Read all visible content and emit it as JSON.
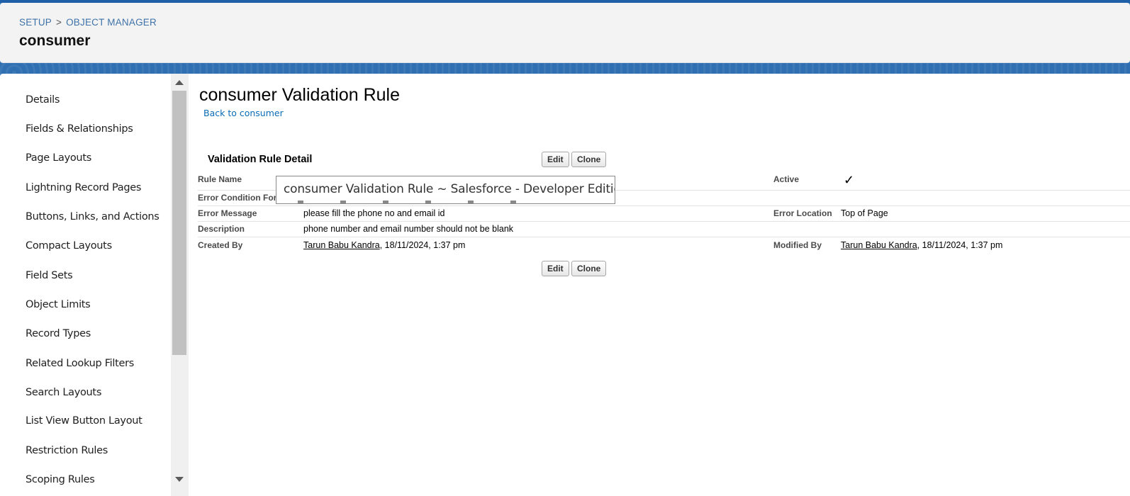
{
  "header": {
    "breadcrumb": {
      "setup": "SETUP",
      "separator": ">",
      "object_manager": "OBJECT MANAGER"
    },
    "object_title": "consumer"
  },
  "sidebar": {
    "items": [
      "Details",
      "Fields & Relationships",
      "Page Layouts",
      "Lightning Record Pages",
      "Buttons, Links, and Actions",
      "Compact Layouts",
      "Field Sets",
      "Object Limits",
      "Record Types",
      "Related Lookup Filters",
      "Search Layouts",
      "List View Button Layout",
      "Restriction Rules",
      "Scoping Rules"
    ]
  },
  "main": {
    "page_title": "consumer Validation Rule",
    "back_link": "Back to consumer",
    "section_title": "Validation Rule Detail",
    "buttons": {
      "edit": "Edit",
      "clone": "Clone"
    },
    "fields": {
      "rule_name_label": "Rule Name",
      "error_condition_label": "Error Condition Formula",
      "error_message_label": "Error Message",
      "error_message_value": "please fill the phone no and email id",
      "description_label": "Description",
      "description_value": "phone number and email number should not be blank",
      "created_by_label": "Created By",
      "created_by_user": "Tarun Babu Kandra",
      "created_by_date": ", 18/11/2024, 1:37 pm",
      "active_label": "Active",
      "active_value": "✓",
      "error_location_label": "Error Location",
      "error_location_value": "Top of Page",
      "modified_by_label": "Modified By",
      "modified_by_user": "Tarun Babu Kandra",
      "modified_by_date": ", 18/11/2024, 1:37 pm"
    },
    "tooltip": "consumer Validation Rule ~ Salesforce - Developer Edition"
  },
  "colors": {
    "brand_blue": "#2e72b8",
    "link": "#0b6cb5",
    "breadcrumb": "#3e72a8"
  }
}
